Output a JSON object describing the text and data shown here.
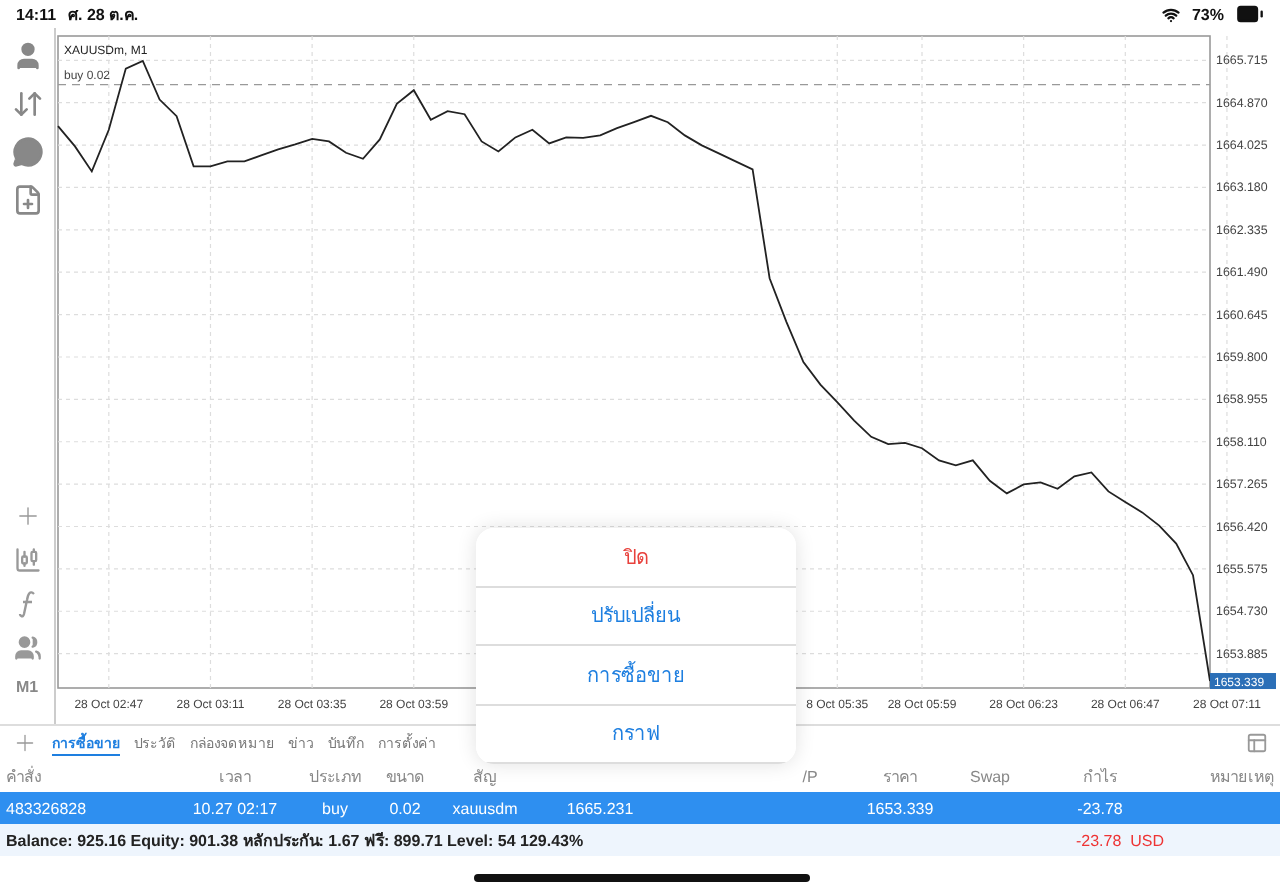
{
  "status_bar": {
    "time": "14:11",
    "date": "ศ. 28 ต.ค.",
    "battery": "73%"
  },
  "toolbar": {
    "timeframe": "M1"
  },
  "chart": {
    "title": "XAUUSDm, M1",
    "current_price": "1653.339",
    "chart_data": {
      "type": "line",
      "ylim": [
        1653.2,
        1666.2
      ],
      "categories": [
        null,
        null,
        null,
        "28 Oct 02:47",
        null,
        null,
        null,
        null,
        null,
        "28 Oct 03:11",
        null,
        null,
        null,
        null,
        null,
        "28 Oct 03:35",
        null,
        null,
        null,
        null,
        null,
        "28 Oct 03:59",
        null,
        null,
        null,
        null,
        null,
        null,
        null,
        null,
        null,
        null,
        null,
        null,
        null,
        null,
        null,
        null,
        null,
        null,
        null,
        null,
        null,
        null,
        null,
        null,
        "8 Oct 05:35",
        null,
        null,
        null,
        null,
        "28 Oct 05:59",
        null,
        null,
        null,
        null,
        null,
        "28 Oct 06:23",
        null,
        null,
        null,
        null,
        null,
        "28 Oct 06:47",
        null,
        null,
        null,
        null,
        null,
        "28 Oct 07:11"
      ],
      "series": [
        {
          "color": "#222222",
          "values": [
            1664.4,
            1664.0,
            1663.5,
            1664.33,
            1665.55,
            1665.7,
            1664.93,
            1664.6,
            1663.6,
            1663.6,
            1663.7,
            1663.7,
            1663.82,
            1663.94,
            1664.04,
            1664.15,
            1664.1,
            1663.87,
            1663.75,
            1664.14,
            1664.85,
            1665.12,
            1664.53,
            1664.7,
            1664.64,
            1664.1,
            1663.9,
            1664.18,
            1664.33,
            1664.06,
            1664.18,
            1664.17,
            1664.22,
            1664.36,
            1664.48,
            1664.61,
            1664.48,
            1664.22,
            1664.02,
            1663.86,
            1663.7,
            1663.54,
            1661.37,
            1660.5,
            1659.7,
            1659.25,
            1658.9,
            1658.53,
            1658.21,
            1658.06,
            1658.09,
            1657.98,
            1657.74,
            1657.64,
            1657.74,
            1657.33,
            1657.08,
            1657.26,
            1657.3,
            1657.17,
            1657.42,
            1657.5,
            1657.12,
            1656.91,
            1656.7,
            1656.44,
            1656.08,
            1655.45,
            1653.34,
            null
          ]
        }
      ],
      "yticks": [
        {
          "value": 1665.715,
          "label": "1665.715"
        },
        {
          "value": 1664.87,
          "label": "1664.870"
        },
        {
          "value": 1664.025,
          "label": "1664.025"
        },
        {
          "value": 1663.18,
          "label": "1663.180"
        },
        {
          "value": 1662.335,
          "label": "1662.335"
        },
        {
          "value": 1661.49,
          "label": "1661.490"
        },
        {
          "value": 1660.645,
          "label": "1660.645"
        },
        {
          "value": 1659.8,
          "label": "1659.800"
        },
        {
          "value": 1658.955,
          "label": "1658.955"
        },
        {
          "value": 1658.11,
          "label": "1658.110"
        },
        {
          "value": 1657.265,
          "label": "1657.265"
        },
        {
          "value": 1656.42,
          "label": "1656.420"
        },
        {
          "value": 1655.575,
          "label": "1655.575"
        },
        {
          "value": 1654.73,
          "label": "1654.730"
        },
        {
          "value": 1653.885,
          "label": "1653.885"
        }
      ],
      "grid": true,
      "ref_lines": [
        {
          "axis": "y",
          "value": 1665.231,
          "label": "buy 0.02"
        }
      ]
    }
  },
  "tabs": [
    {
      "label": "การซื้อขาย",
      "selected": true
    },
    {
      "label": "ประวัติ",
      "selected": false
    },
    {
      "label": "กล่องจดหมาย",
      "selected": false
    },
    {
      "label": "ข่าว",
      "selected": false
    },
    {
      "label": "บันทึก",
      "selected": false
    },
    {
      "label": "การตั้งค่า",
      "selected": false
    }
  ],
  "table": {
    "columns": [
      {
        "label": "คำสั่ง"
      },
      {
        "label": "เวลา"
      },
      {
        "label": "ประเภท"
      },
      {
        "label": "ขนาด"
      },
      {
        "label": "สัญ"
      },
      {},
      {},
      {
        "label": "/P"
      },
      {
        "label": "ราคา"
      },
      {
        "label": "Swap"
      },
      {
        "label": "กำไร"
      },
      {
        "label": "หมายเหตุ"
      }
    ],
    "rows": [
      {
        "selected": true,
        "cells": [
          "483326828",
          "10.27 02:17",
          "buy",
          "0.02",
          "xauusdm",
          "1665.231",
          null,
          null,
          "1653.339",
          null,
          "-23.78",
          null
        ]
      }
    ]
  },
  "summary": {
    "text": "Balance: 925.16 Equity: 901.38 หลักประกัน: 1.67 ฟรี: 899.71 Level: 54 129.43%",
    "profit": "-23.78",
    "currency": "USD"
  },
  "action_sheet": {
    "items": [
      {
        "label": "ปิด",
        "kind": "destructive"
      },
      {
        "label": "ปรับเปลี่ยน",
        "kind": "default"
      },
      {
        "label": "การซื้อขาย",
        "kind": "default"
      },
      {
        "label": "กราฟ",
        "kind": "default"
      }
    ]
  }
}
